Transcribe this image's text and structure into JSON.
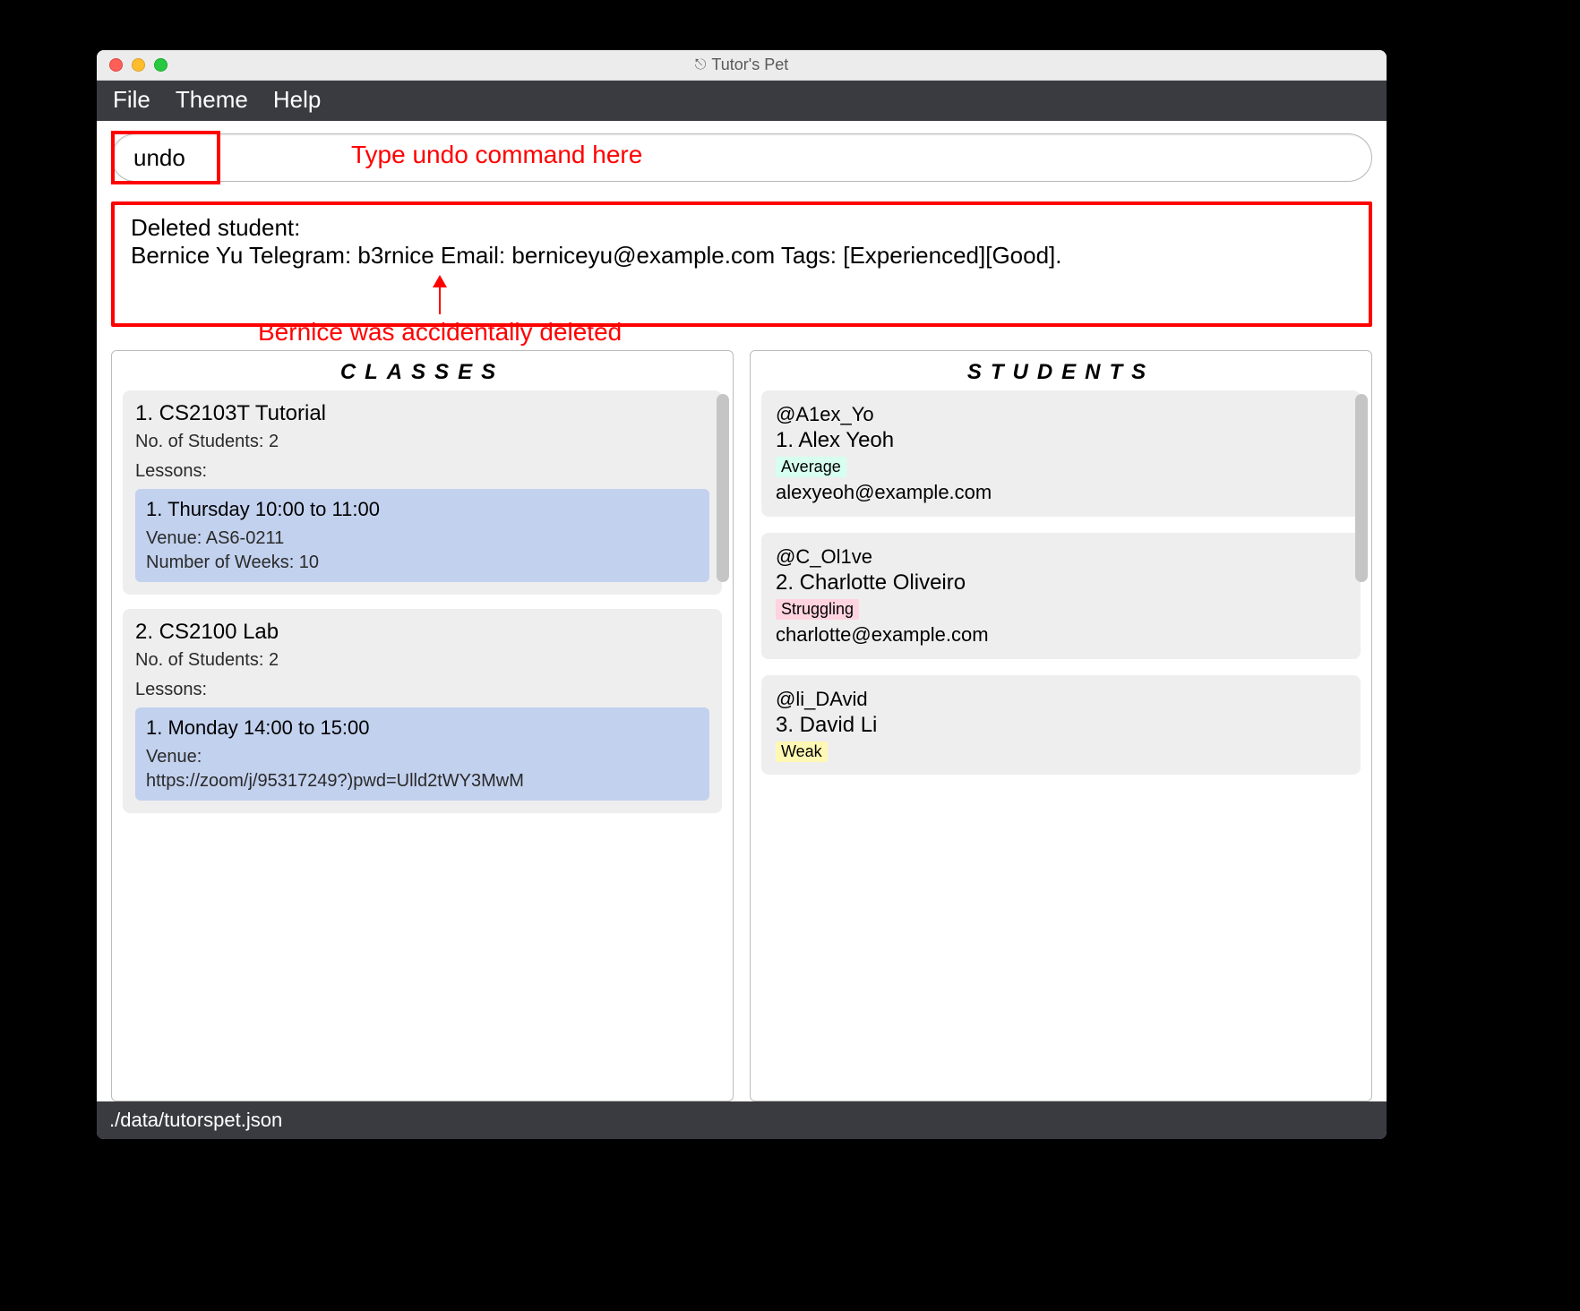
{
  "window": {
    "title": "Tutor's Pet"
  },
  "menu": {
    "file": "File",
    "theme": "Theme",
    "help": "Help"
  },
  "command": {
    "value": "undo"
  },
  "annotations": {
    "cmd_hint": "Type undo command here",
    "deleted_hint": "Bernice was accidentally deleted"
  },
  "result": {
    "line1": "Deleted student:",
    "line2": "Bernice Yu Telegram: b3rnice Email: berniceyu@example.com Tags: [Experienced][Good]."
  },
  "panels": {
    "classes_title": "CLASSES",
    "students_title": "STUDENTS"
  },
  "classes": [
    {
      "title": "1.  CS2103T Tutorial",
      "students": "No. of Students:  2",
      "lessons_label": "Lessons:",
      "lesson": {
        "title": "1. Thursday 10:00 to 11:00",
        "venue": "Venue: AS6-0211",
        "weeks": "Number of Weeks: 10"
      }
    },
    {
      "title": "2.  CS2100 Lab",
      "students": "No. of Students:  2",
      "lessons_label": "Lessons:",
      "lesson": {
        "title": "1. Monday 14:00 to 15:00",
        "venue_label": "Venue:",
        "venue_url": "https://zoom/j/95317249?)pwd=Ulld2tWY3MwM"
      }
    }
  ],
  "students": [
    {
      "handle": "@A1ex_Yo",
      "name": "1.  Alex Yeoh",
      "tag": "Average",
      "tag_cls": "average",
      "email": "alexyeoh@example.com"
    },
    {
      "handle": "@C_Ol1ve",
      "name": "2.  Charlotte Oliveiro",
      "tag": "Struggling",
      "tag_cls": "struggling",
      "email": "charlotte@example.com"
    },
    {
      "handle": "@li_DAvid",
      "name": "3.  David Li",
      "tag": "Weak",
      "tag_cls": "weak",
      "email": ""
    }
  ],
  "status": {
    "path": "./data/tutorspet.json"
  }
}
